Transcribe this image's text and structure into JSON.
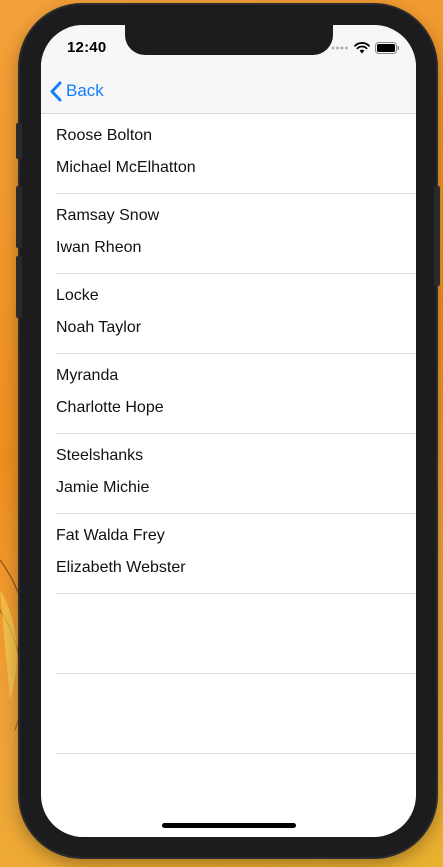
{
  "status_bar": {
    "time": "12:40",
    "icons": [
      "cellular-dots-icon",
      "wifi-icon",
      "battery-icon"
    ]
  },
  "nav": {
    "back_label": "Back",
    "back_icon": "chevron-left-icon",
    "accent_color": "#147efb"
  },
  "list": {
    "items": [
      {
        "title": "Roose Bolton",
        "subtitle": "Michael McElhatton"
      },
      {
        "title": "Ramsay Snow",
        "subtitle": "Iwan Rheon"
      },
      {
        "title": "Locke",
        "subtitle": "Noah Taylor"
      },
      {
        "title": "Myranda",
        "subtitle": "Charlotte Hope"
      },
      {
        "title": "Steelshanks",
        "subtitle": "Jamie Michie"
      },
      {
        "title": "Fat Walda Frey",
        "subtitle": "Elizabeth Webster"
      },
      {
        "title": "",
        "subtitle": ""
      },
      {
        "title": "",
        "subtitle": ""
      }
    ]
  }
}
